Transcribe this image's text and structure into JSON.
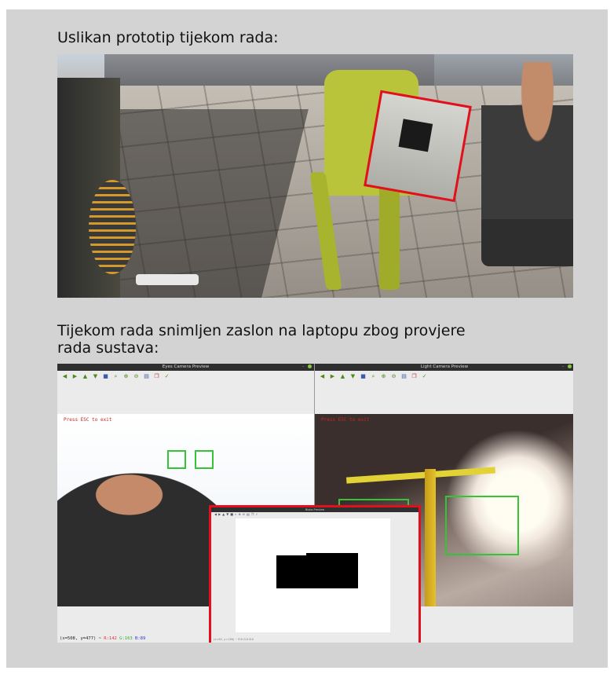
{
  "captions": {
    "photo": "Uslikan prototip tijekom rada:",
    "screenshot": "Tijekom rada snimljen zaslon na laptopu zbog provjere\nrada sustava:"
  },
  "windows": {
    "left": {
      "title": "Eyes Camera Preview",
      "overlay_text": "Press ESC to exit",
      "status": {
        "coords": "(x=508, y=477) ~ ",
        "r": "R:142",
        "g": "G:163",
        "b": "B:89"
      }
    },
    "right": {
      "title": "Light Camera Preview",
      "overlay_text": "Press ESC to exit"
    },
    "popup": {
      "title": "Blobs Preview",
      "status": "(x=62, y=138) ~ R:0 G:0 B:0"
    }
  },
  "toolbar_icons": [
    "arrow-left-icon",
    "arrow-right-icon",
    "arrow-up-icon",
    "arrow-down-icon",
    "save-icon",
    "zoom-fit-icon",
    "zoom-in-icon",
    "zoom-out-icon",
    "properties-icon",
    "copy-icon",
    "settings-icon"
  ],
  "colors": {
    "highlight": "#e1101c",
    "detection_box": "#35c435",
    "panel_bg": "#d3d3d3"
  }
}
